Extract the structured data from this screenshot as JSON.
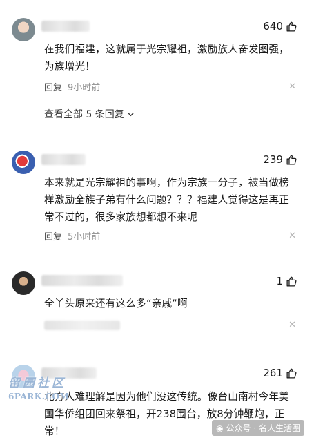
{
  "comments": [
    {
      "likes": "640",
      "text": "在我们福建，这就属于光宗耀祖，激励族人奋发图强，为族增光！",
      "reply_label": "回复",
      "time": "9小时前",
      "view_replies": "查看全部 5 条回复"
    },
    {
      "likes": "239",
      "text": "本来就是光宗耀祖的事啊，作为宗族一分子，被当做榜样激励全族子弟有什么问题？？？福建人觉得这是再正常不过的，很多家族想都想不来呢",
      "reply_label": "回复",
      "time": "5小时前"
    },
    {
      "likes": "1",
      "text": "全丫头原来还有这么多“亲戚”啊"
    },
    {
      "likes": "261",
      "text": "北方人难理解是因为他们没这传统。像台山南村今年美国华侨组团回来祭祖，开238围台，放8分钟鞭炮，正常！"
    }
  ],
  "icons": {
    "like": "thumbs-up-icon",
    "close": "close-icon",
    "chevron": "chevron-down-icon"
  },
  "watermark": {
    "left_cn": "留园社区",
    "left_en": "6PARK.COM",
    "right": "公众号 · 名人生活圈"
  },
  "colors": {
    "text": "#191919",
    "meta": "#8c8c8c",
    "close": "#b3b3b3"
  }
}
